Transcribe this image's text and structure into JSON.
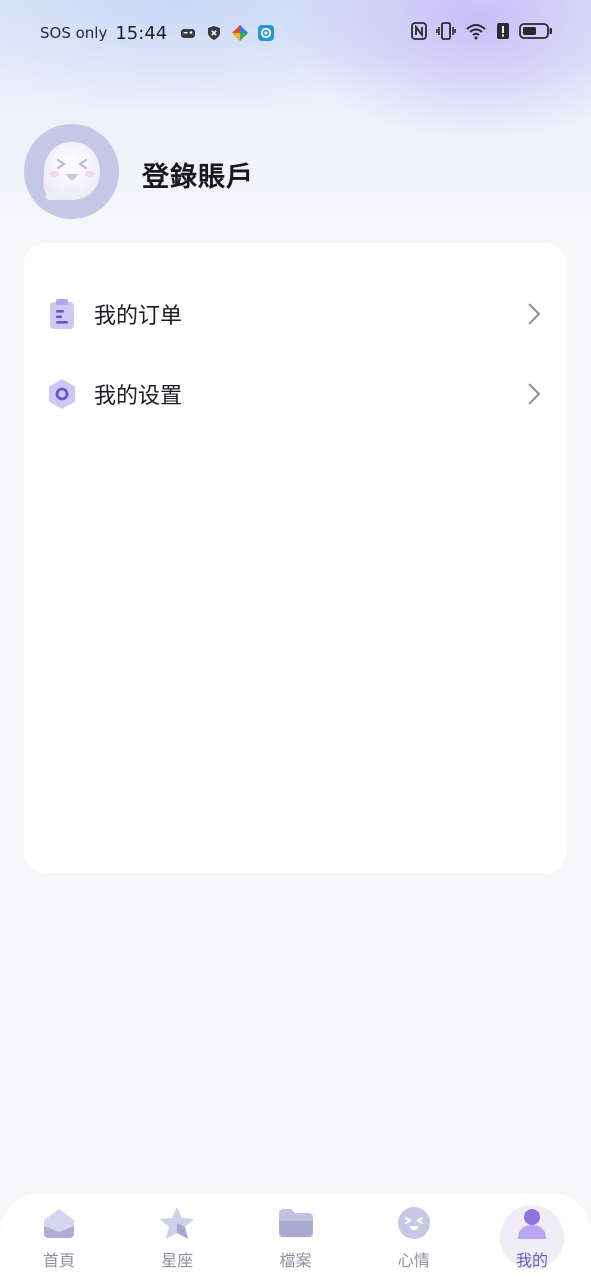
{
  "status_bar": {
    "network": "SOS only",
    "time": "15:44"
  },
  "profile": {
    "login_label": "登錄賬戶"
  },
  "menu": {
    "items": [
      {
        "label": "我的订单",
        "icon": "clipboard-icon"
      },
      {
        "label": "我的设置",
        "icon": "settings-hexagon-icon"
      }
    ]
  },
  "bottom_nav": {
    "items": [
      {
        "label": "首頁",
        "icon": "home-icon",
        "active": false
      },
      {
        "label": "星座",
        "icon": "star-icon",
        "active": false
      },
      {
        "label": "檔案",
        "icon": "folder-icon",
        "active": false
      },
      {
        "label": "心情",
        "icon": "mood-face-icon",
        "active": false
      },
      {
        "label": "我的",
        "icon": "person-icon",
        "active": true
      }
    ]
  },
  "colors": {
    "accent": "#6d55c8",
    "icon_light": "#c9c3f4",
    "nav_inactive": "#8f90a6",
    "avatar_bg": "#c6c7e6"
  }
}
